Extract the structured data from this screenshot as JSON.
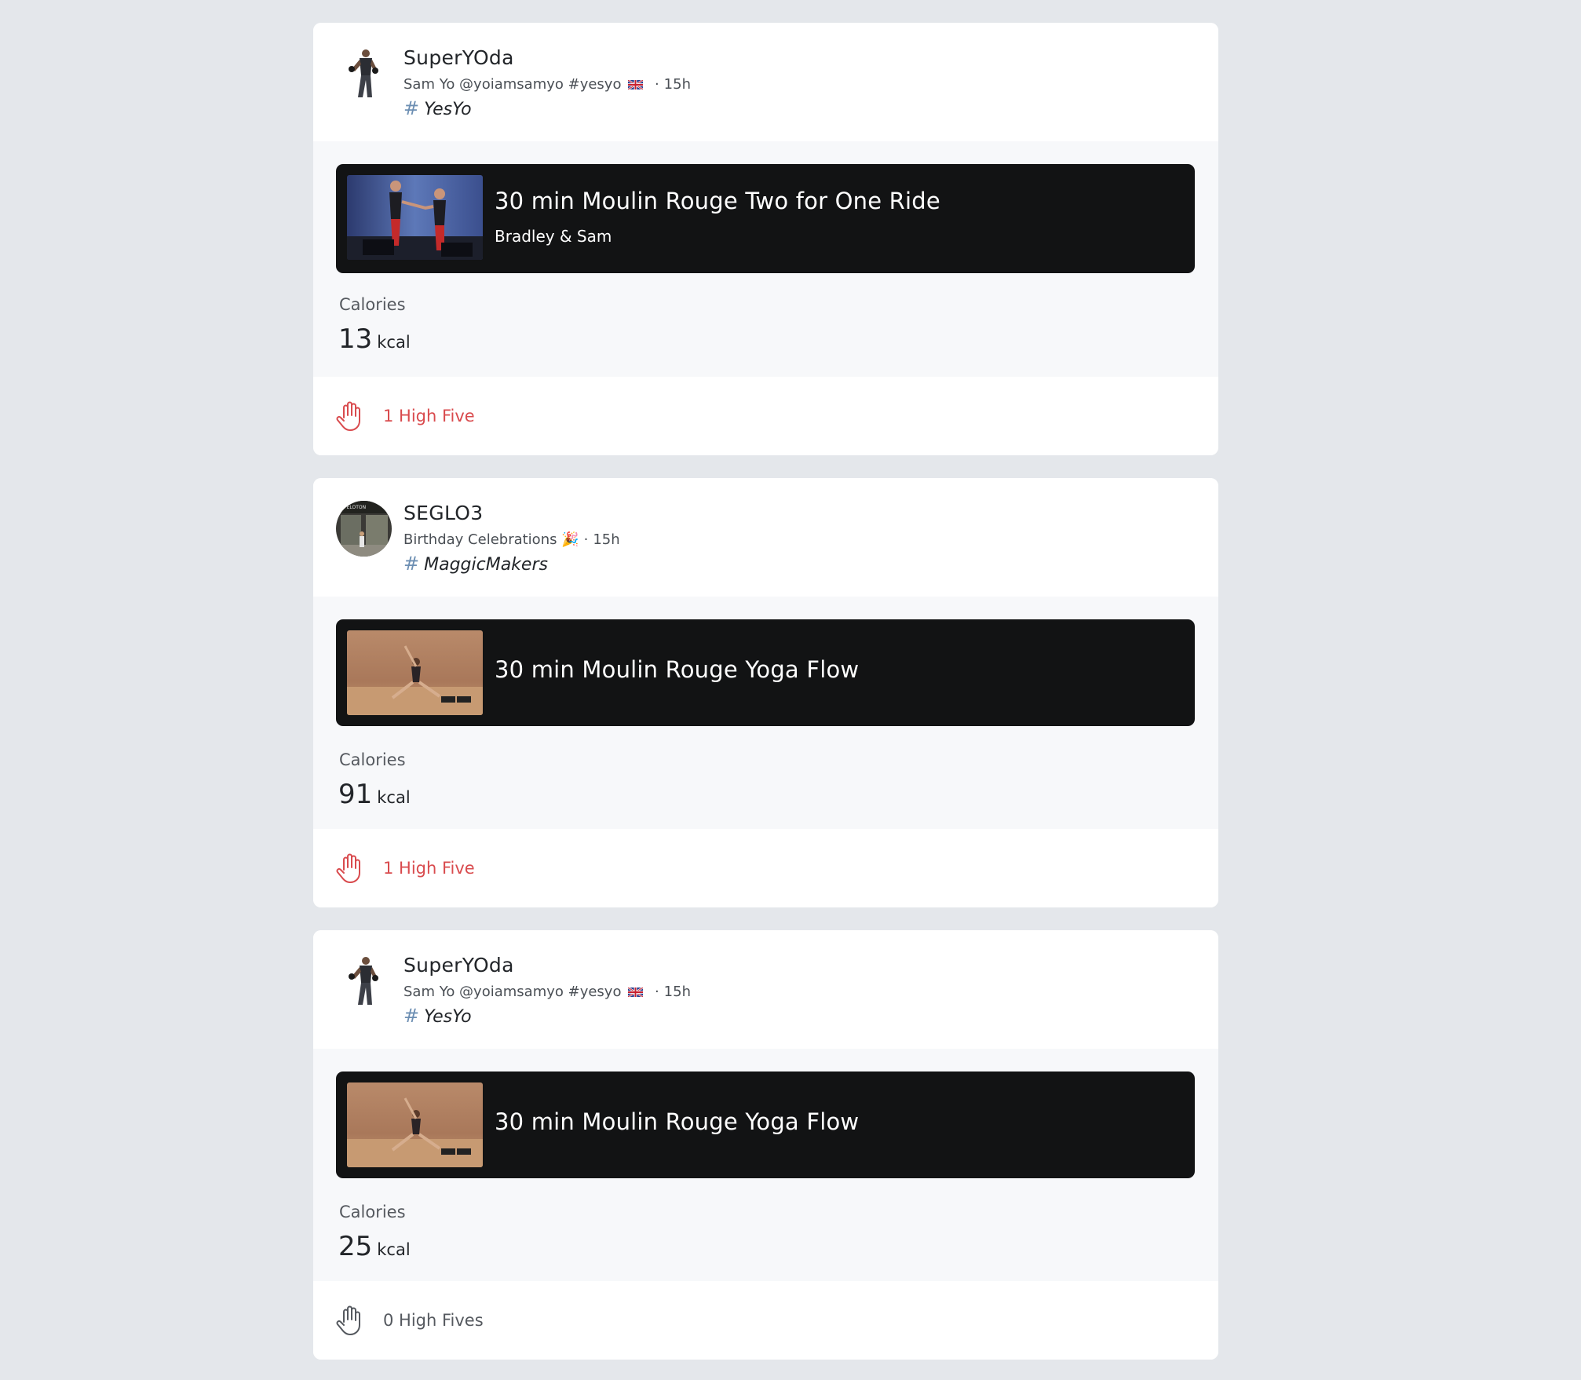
{
  "colors": {
    "page_bg": "#e4e7eb",
    "card_bg": "#ffffff",
    "tile_bg": "#121314",
    "accent_red": "#d94b4e",
    "hashtag_blue": "#6d8fb3"
  },
  "posts": [
    {
      "username": "SuperYOda",
      "subtitle": "Sam Yo @yoiamsamyo #yesyo",
      "flag_icon": "uk-flag-icon",
      "time": "15h",
      "hashtag": "YesYo",
      "class_title": "30 min Moulin Rouge Two for One Ride",
      "instructor": "Bradley & Sam",
      "calories_label": "Calories",
      "calories_value": "13",
      "calories_unit": "kcal",
      "high_five_text": "1 High Five"
    },
    {
      "username": "SEGLO3",
      "subtitle": "Birthday Celebrations 🎉",
      "time": "15h",
      "hashtag": "MaggicMakers",
      "class_title": "30 min Moulin Rouge Yoga Flow",
      "calories_label": "Calories",
      "calories_value": "91",
      "calories_unit": "kcal",
      "high_five_text": "1 High Five"
    },
    {
      "username": "SuperYOda",
      "subtitle": "Sam Yo @yoiamsamyo #yesyo",
      "flag_icon": "uk-flag-icon",
      "time": "15h",
      "hashtag": "YesYo",
      "class_title": "30 min Moulin Rouge Yoga Flow",
      "calories_label": "Calories",
      "calories_value": "25",
      "calories_unit": "kcal",
      "high_five_text": "0 High Fives"
    }
  ]
}
